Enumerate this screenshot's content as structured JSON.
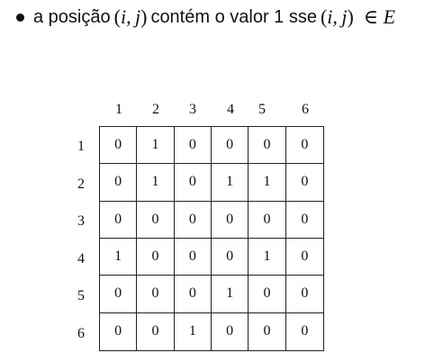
{
  "bullet": {
    "prefix": "a posição",
    "pair": {
      "open": "(",
      "i": "i",
      "comma": ",",
      "j": "j",
      "close": ")"
    },
    "middle": "contém o valor 1 sse",
    "pair2": {
      "open": "(",
      "i": "i",
      "comma": ",",
      "j": "j",
      "close": ")"
    },
    "element_of": "∈",
    "set": "E"
  },
  "matrix": {
    "column_headers": [
      "1",
      "2",
      "3",
      "4",
      "5",
      "6"
    ],
    "row_headers": [
      "1",
      "2",
      "3",
      "4",
      "5",
      "6"
    ],
    "rows": [
      [
        "0",
        "1",
        "0",
        "0",
        "0",
        "0"
      ],
      [
        "0",
        "1",
        "0",
        "1",
        "1",
        "0"
      ],
      [
        "0",
        "0",
        "0",
        "0",
        "0",
        "0"
      ],
      [
        "1",
        "0",
        "0",
        "0",
        "1",
        "0"
      ],
      [
        "0",
        "0",
        "0",
        "1",
        "0",
        "0"
      ],
      [
        "0",
        "0",
        "1",
        "0",
        "0",
        "0"
      ]
    ]
  }
}
